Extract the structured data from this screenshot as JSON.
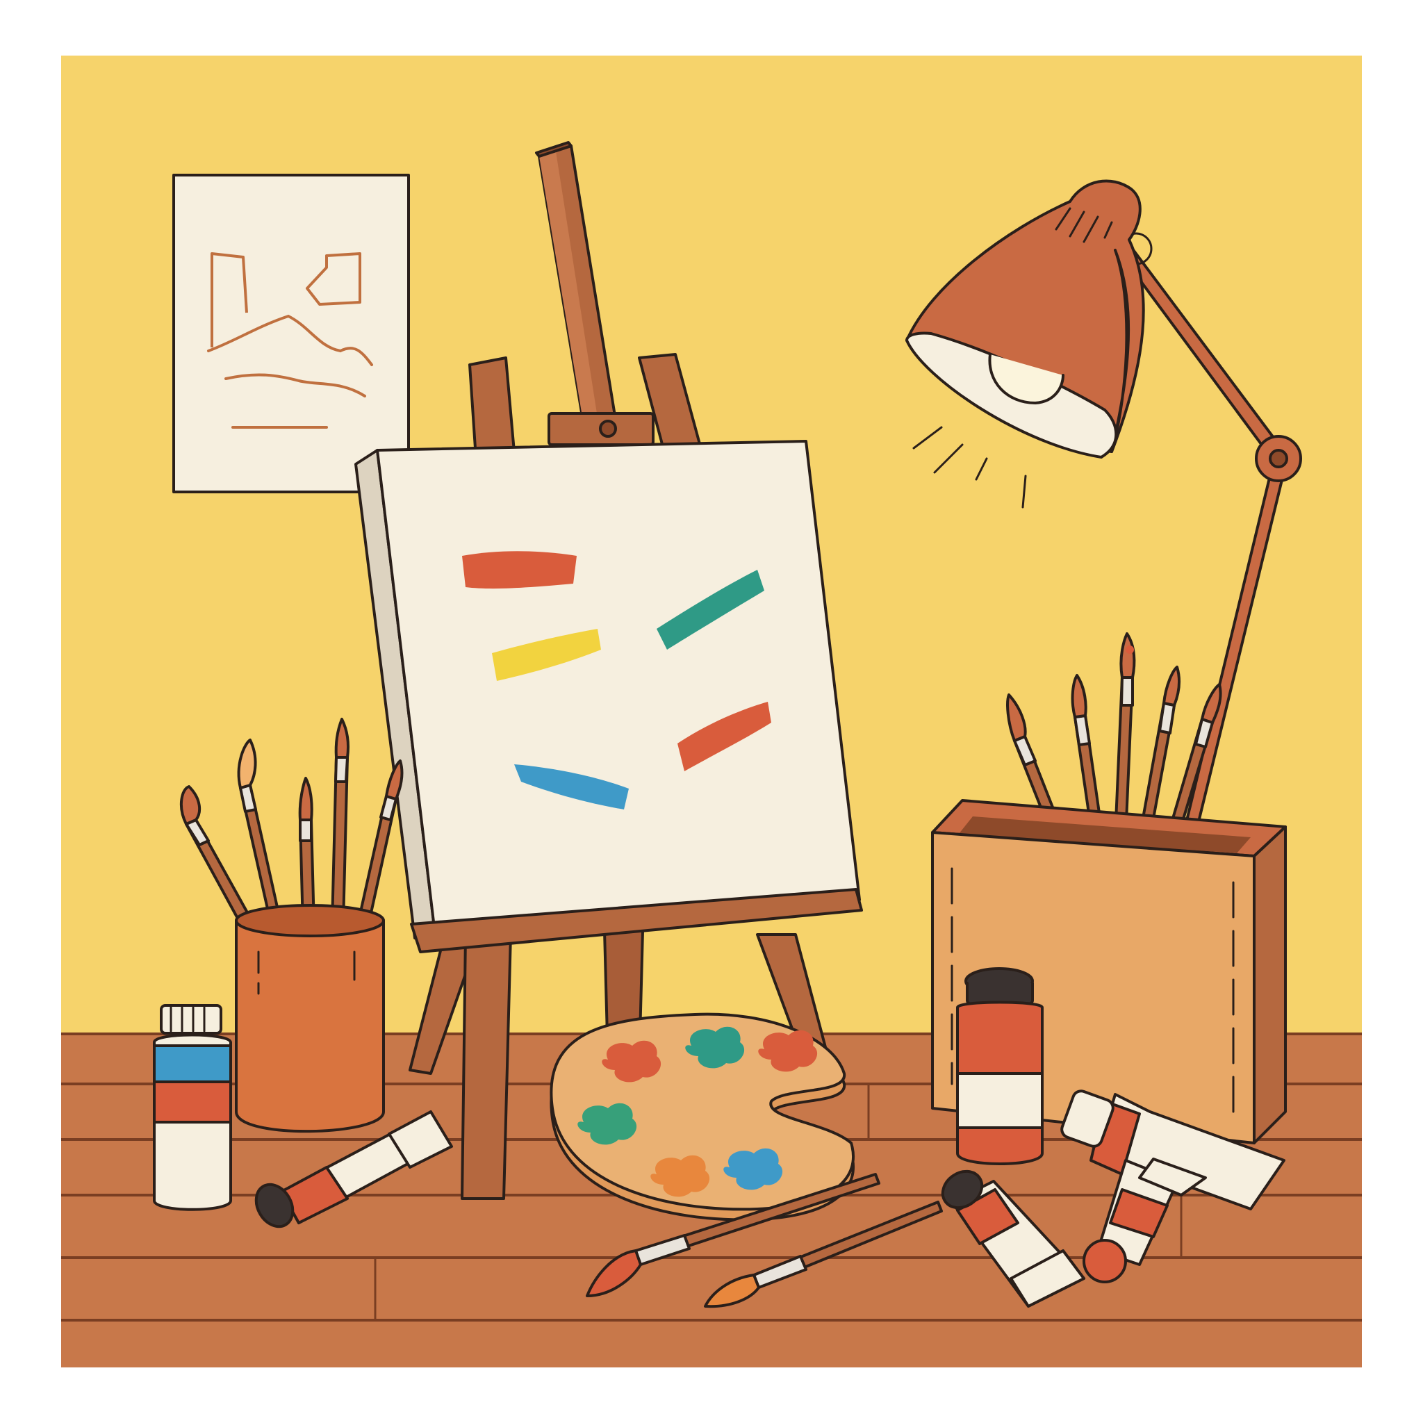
{
  "scene": {
    "subject": "art studio",
    "colors": {
      "wall": "#f6d36b",
      "floor": "#c8784a",
      "floor_lines": "#7a3e22",
      "wood": "#b5683f",
      "wood_dark": "#8e4a2a",
      "canvas": "#f6efdf",
      "lamp": "#c96a43",
      "box": "#e8a867",
      "palette": "#eab173",
      "paint_red": "#d95c3c",
      "paint_teal": "#2f9a86",
      "paint_yellow": "#f2d33f",
      "paint_blue": "#3f9ac8",
      "paint_orange": "#e8873d",
      "paint_green": "#37a07a"
    },
    "icons": [
      "framed-sketch-icon",
      "easel-icon",
      "canvas-icon",
      "desk-lamp-icon",
      "brush-cup-icon",
      "brush-box-icon",
      "paint-bottle-icon",
      "paint-tube-icon",
      "paint-palette-icon",
      "paintbrush-icon"
    ]
  }
}
